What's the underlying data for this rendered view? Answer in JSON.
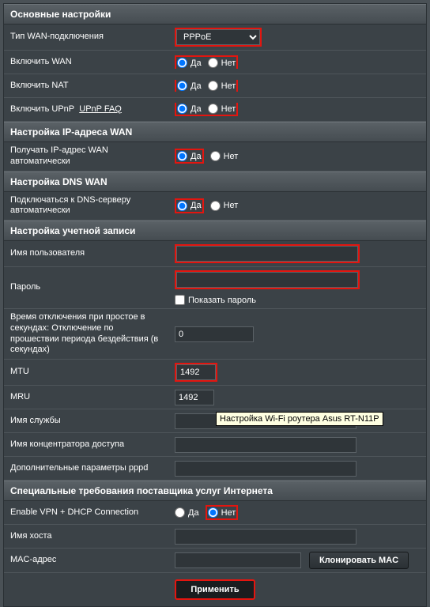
{
  "sections": {
    "basic": "Основные настройки",
    "wanip": "Настройка IP-адреса WAN",
    "dns": "Настройка DNS WAN",
    "account": "Настройка учетной записи",
    "isp": "Специальные требования поставщика услуг Интернета"
  },
  "labels": {
    "wan_type": "Тип WAN-подключения",
    "enable_wan": "Включить WAN",
    "enable_nat": "Включить NAT",
    "enable_upnp": "Включить UPnP",
    "upnp_faq": "UPnP  FAQ",
    "get_wan_ip": "Получать IP-адрес WAN автоматически",
    "dns_auto": "Подключаться к DNS-серверу автоматически",
    "username": "Имя пользователя",
    "password": "Пароль",
    "show_password": "Показать пароль",
    "idle": "Время отключения при простое в секундах: Отключение по прошествии периода бездействия (в секундах)",
    "mtu": "MTU",
    "mru": "MRU",
    "service": "Имя службы",
    "concentrator": "Имя концентратора доступа",
    "pppd_extra": "Дополнительные параметры pppd",
    "vpn_dhcp": "Enable VPN + DHCP Connection",
    "hostname": "Имя хоста",
    "mac": "MAC-адрес"
  },
  "radio": {
    "yes": "Да",
    "no": "Нет"
  },
  "values": {
    "wan_type": "PPPoE",
    "enable_wan": "yes",
    "enable_nat": "yes",
    "enable_upnp": "yes",
    "get_wan_ip": "yes",
    "dns_auto": "yes",
    "username": "",
    "password": "",
    "idle": "0",
    "mtu": "1492",
    "mru": "1492",
    "service": "",
    "concentrator": "",
    "pppd_extra": "",
    "vpn_dhcp": "no",
    "hostname": "",
    "mac": ""
  },
  "buttons": {
    "clone_mac": "Клонировать MAC",
    "apply": "Применить"
  },
  "tooltip": "Настройка Wi-Fi роутера Asus RT-N11P"
}
